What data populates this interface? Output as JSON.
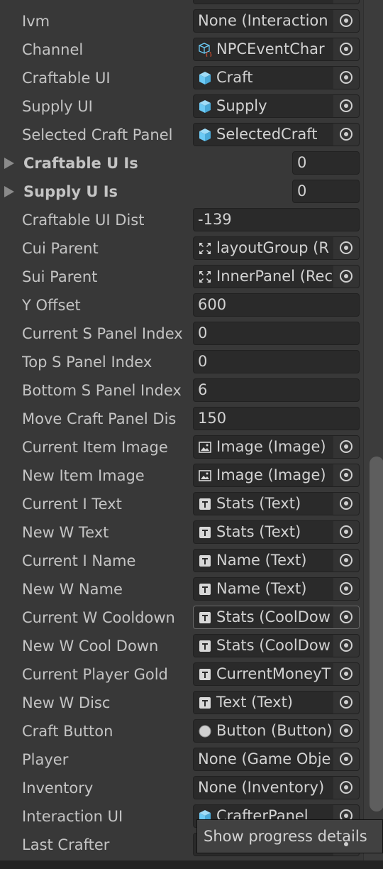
{
  "rows": [
    {
      "label": "",
      "type": "object",
      "value": "",
      "icon": ""
    },
    {
      "label": "Ivm",
      "type": "object",
      "value": "None (Interaction",
      "icon": ""
    },
    {
      "label": "Channel",
      "type": "object",
      "value": "NPCEventChar",
      "icon": "scriptable-object-icon"
    },
    {
      "label": "Craftable UI",
      "type": "object",
      "value": "Craft",
      "icon": "prefab-cube-icon"
    },
    {
      "label": "Supply UI",
      "type": "object",
      "value": "Supply",
      "icon": "prefab-cube-icon"
    },
    {
      "label": "Selected Craft Panel",
      "type": "object",
      "value": "SelectedCraft",
      "icon": "prefab-cube-icon"
    },
    {
      "label": "Craftable U Is",
      "type": "array",
      "value": "0"
    },
    {
      "label": "Supply U Is",
      "type": "array",
      "value": "0"
    },
    {
      "label": "Craftable UI Dist",
      "type": "number",
      "value": "-139"
    },
    {
      "label": "Cui Parent",
      "type": "object",
      "value": "layoutGroup (R",
      "icon": "rect-transform-icon"
    },
    {
      "label": "Sui Parent",
      "type": "object",
      "value": "InnerPanel (Rec",
      "icon": "rect-transform-icon"
    },
    {
      "label": "Y Offset",
      "type": "number",
      "value": "600"
    },
    {
      "label": "Current S Panel Index",
      "type": "number",
      "value": "0"
    },
    {
      "label": "Top S Panel Index",
      "type": "number",
      "value": "0"
    },
    {
      "label": "Bottom S Panel Index",
      "type": "number",
      "value": "6"
    },
    {
      "label": "Move Craft Panel Dis",
      "type": "number",
      "value": "150"
    },
    {
      "label": "Current Item Image",
      "type": "object",
      "value": "Image (Image)",
      "icon": "image-icon"
    },
    {
      "label": "New Item Image",
      "type": "object",
      "value": "Image (Image)",
      "icon": "image-icon"
    },
    {
      "label": "Current I Text",
      "type": "object",
      "value": "Stats (Text)",
      "icon": "text-icon"
    },
    {
      "label": "New W Text",
      "type": "object",
      "value": "Stats (Text)",
      "icon": "text-icon"
    },
    {
      "label": "Current I Name",
      "type": "object",
      "value": "Name (Text)",
      "icon": "text-icon"
    },
    {
      "label": "New W Name",
      "type": "object",
      "value": "Name (Text)",
      "icon": "text-icon"
    },
    {
      "label": "Current W Cooldown",
      "type": "object",
      "value": "Stats (CoolDow",
      "icon": "text-icon",
      "highlighted": true
    },
    {
      "label": "New W Cool Down",
      "type": "object",
      "value": "Stats (CoolDow",
      "icon": "text-icon"
    },
    {
      "label": "Current Player Gold",
      "type": "object",
      "value": "CurrentMoneyT",
      "icon": "text-icon"
    },
    {
      "label": "New W Disc",
      "type": "object",
      "value": "Text (Text)",
      "icon": "text-icon"
    },
    {
      "label": "Craft Button",
      "type": "object",
      "value": "Button (Button)",
      "icon": "button-icon"
    },
    {
      "label": "Player",
      "type": "object",
      "value": "None (Game Obje",
      "icon": ""
    },
    {
      "label": "Inventory",
      "type": "object",
      "value": "None (Inventory)",
      "icon": ""
    },
    {
      "label": "Interaction UI",
      "type": "object",
      "value": "CrafterPanel",
      "icon": "prefab-cube-icon"
    },
    {
      "label": "Last Crafter",
      "type": "object",
      "value": "",
      "icon": ""
    }
  ],
  "tooltip": {
    "text": "Show progress details"
  },
  "colors": {
    "background": "#383838",
    "field": "#2a2a2a",
    "text": "#c4c4c4",
    "prefab": "#6ccaf5"
  },
  "scrollbar": {
    "position_fraction": 0.55
  }
}
